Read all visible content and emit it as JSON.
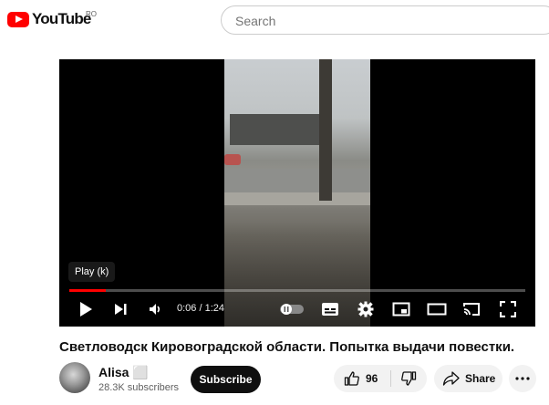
{
  "masthead": {
    "logo_text": "YouTube",
    "country_code": "RO",
    "search_placeholder": "Search"
  },
  "player": {
    "tooltip": "Play (k)",
    "time": "0:06 / 1:24",
    "progress_fraction": 0.08,
    "accent_color": "#ff0000",
    "controls": [
      "play-icon",
      "next-icon",
      "volume-icon",
      "autoplay-toggle-icon",
      "subtitles-icon",
      "settings-icon",
      "miniplayer-icon",
      "theater-mode-icon",
      "cast-icon",
      "fullscreen-icon"
    ]
  },
  "video": {
    "title": "Светловодск Кировоградской области. Попытка выдачи повестки.",
    "channel": {
      "name": "Alisa ⬜",
      "subscribers": "28.3K subscribers",
      "subscribe_label": "Subscribe"
    },
    "actions": {
      "likes": "96",
      "share_label": "Share"
    }
  }
}
